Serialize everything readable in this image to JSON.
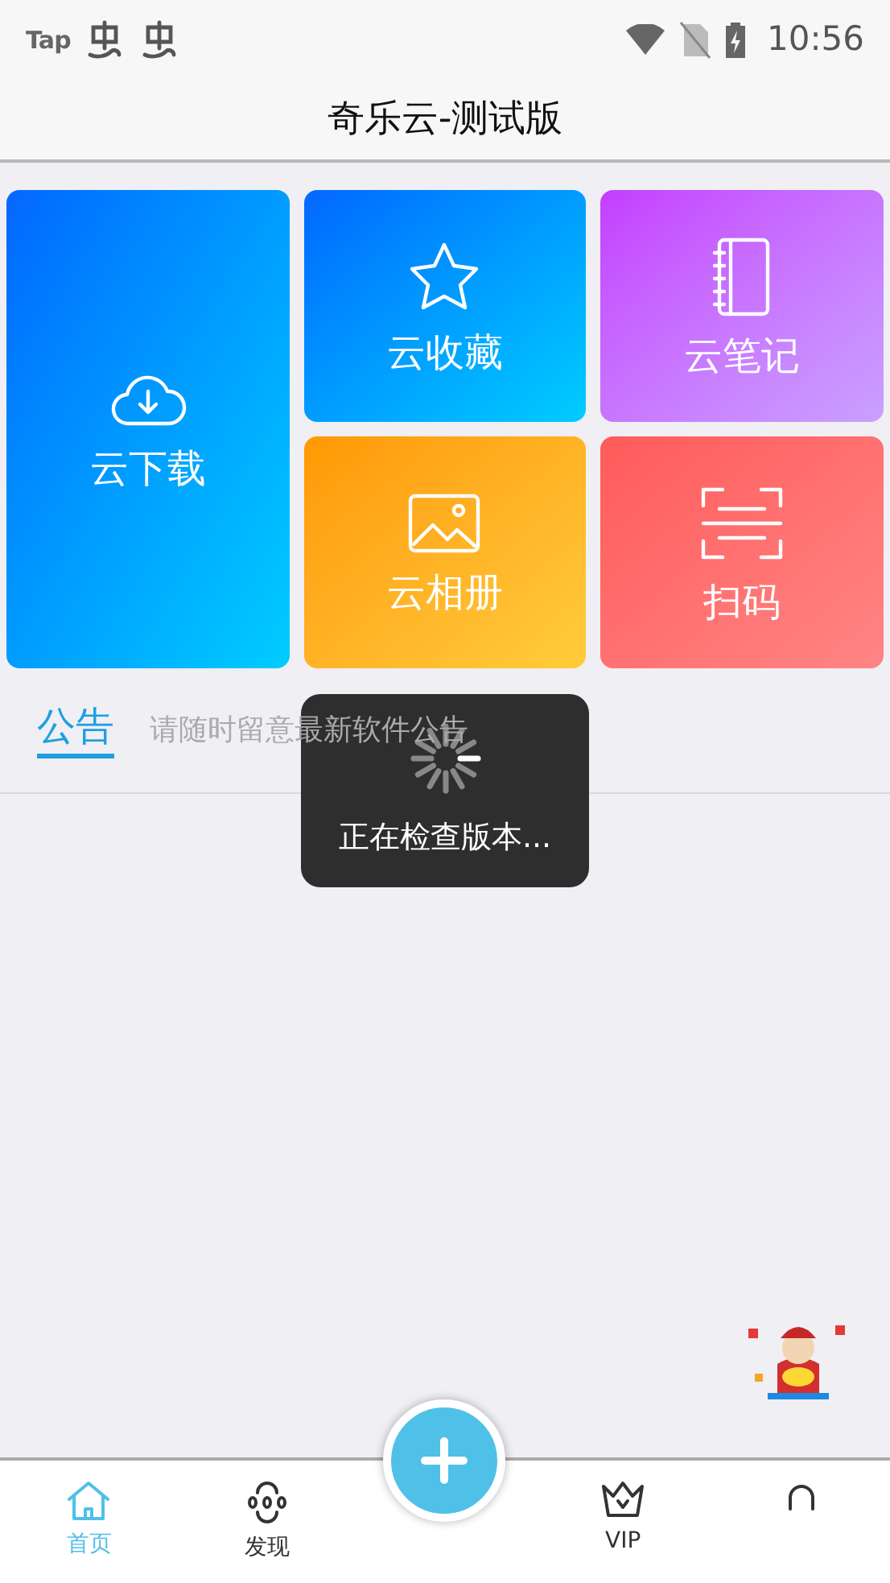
{
  "status_bar": {
    "logo": "Tap",
    "time": "10:56"
  },
  "title": "奇乐云-测试版",
  "tiles": [
    {
      "kind": "download",
      "label": "云下载"
    },
    {
      "kind": "favorite",
      "label": "云收藏"
    },
    {
      "kind": "notes",
      "label": "云笔记"
    },
    {
      "kind": "album",
      "label": "云相册"
    },
    {
      "kind": "scan",
      "label": "扫码"
    }
  ],
  "notice": {
    "tab": "公告",
    "text": "请随时留意最新软件公告"
  },
  "toast": {
    "text": "正在检查版本..."
  },
  "nav": [
    {
      "kind": "home",
      "label": "首页",
      "selected": true
    },
    {
      "kind": "discover",
      "label": "发现",
      "selected": false
    },
    {
      "kind": "add"
    },
    {
      "kind": "vip",
      "label": "VIP",
      "selected": false
    },
    {
      "kind": "profile",
      "selected": false
    }
  ]
}
